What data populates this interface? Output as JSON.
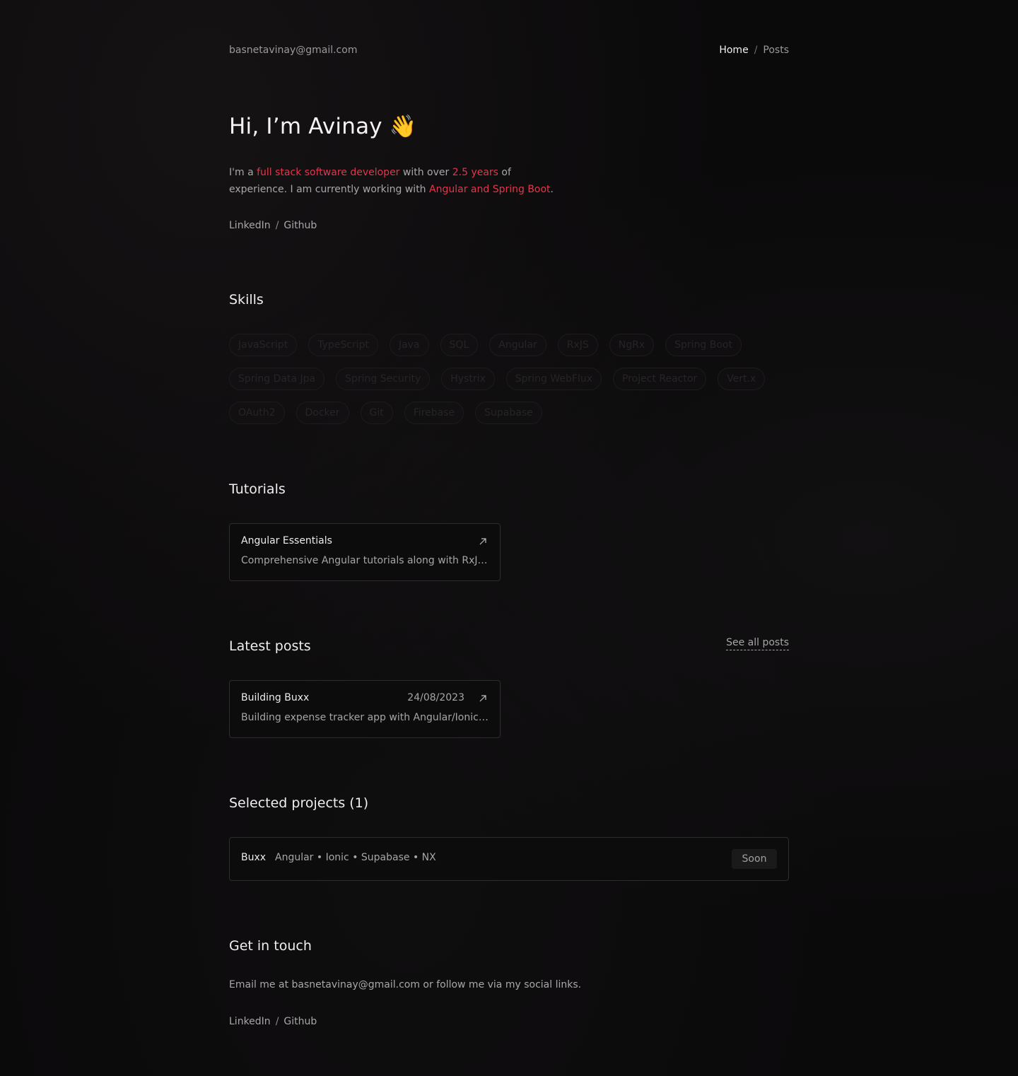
{
  "header": {
    "email": "basnetavinay@gmail.com",
    "nav": {
      "home": "Home",
      "separator": "/",
      "posts": "Posts"
    }
  },
  "hero": {
    "greeting": "Hi, I’m Avinay",
    "wave_emoji": "👋",
    "intro_1": "I'm a ",
    "intro_hl_1": "full stack software developer",
    "intro_2": " with over ",
    "intro_hl_2": "2.5 years",
    "intro_3": " of experience. I am currently working with ",
    "intro_hl_3": "Angular and Spring Boot",
    "intro_4": ".",
    "social": {
      "linkedin": "LinkedIn",
      "separator": "/",
      "github": "Github"
    }
  },
  "skills": {
    "heading": "Skills",
    "rows": [
      [
        "JavaScript",
        "TypeScript",
        "Java",
        "SQL",
        "Angular",
        "RxJS",
        "NgRx",
        "Spring Boot"
      ],
      [
        "Spring Data Jpa",
        "Spring Security",
        "Hystrix",
        "Spring WebFlux",
        "Project Reactor",
        "Vert.x"
      ],
      [
        "OAuth2",
        "Docker",
        "Git",
        "Firebase",
        "Supabase"
      ]
    ]
  },
  "tutorials": {
    "heading": "Tutorials",
    "items": [
      {
        "title": "Angular Essentials",
        "description": "Comprehensive Angular tutorials along with RxJS and NgRx"
      }
    ]
  },
  "posts": {
    "heading": "Latest posts",
    "see_all": "See all posts",
    "items": [
      {
        "title": "Building Buxx",
        "date": "24/08/2023",
        "description": "Building expense tracker app with Angular/Ionic/Supabase"
      }
    ]
  },
  "projects": {
    "heading": "Selected projects (1)",
    "items": [
      {
        "name": "Buxx",
        "tech": "Angular • Ionic • Supabase • NX",
        "status": "Soon"
      }
    ]
  },
  "contact": {
    "heading": "Get in touch",
    "text": "Email me at basnetavinay@gmail.com or follow me via my social links.",
    "social": {
      "linkedin": "LinkedIn",
      "separator": "/",
      "github": "Github"
    }
  },
  "colors": {
    "accent": "#e2364c",
    "background": "#0b0a0b",
    "text": "#a8a8a8",
    "heading": "#efefef"
  }
}
